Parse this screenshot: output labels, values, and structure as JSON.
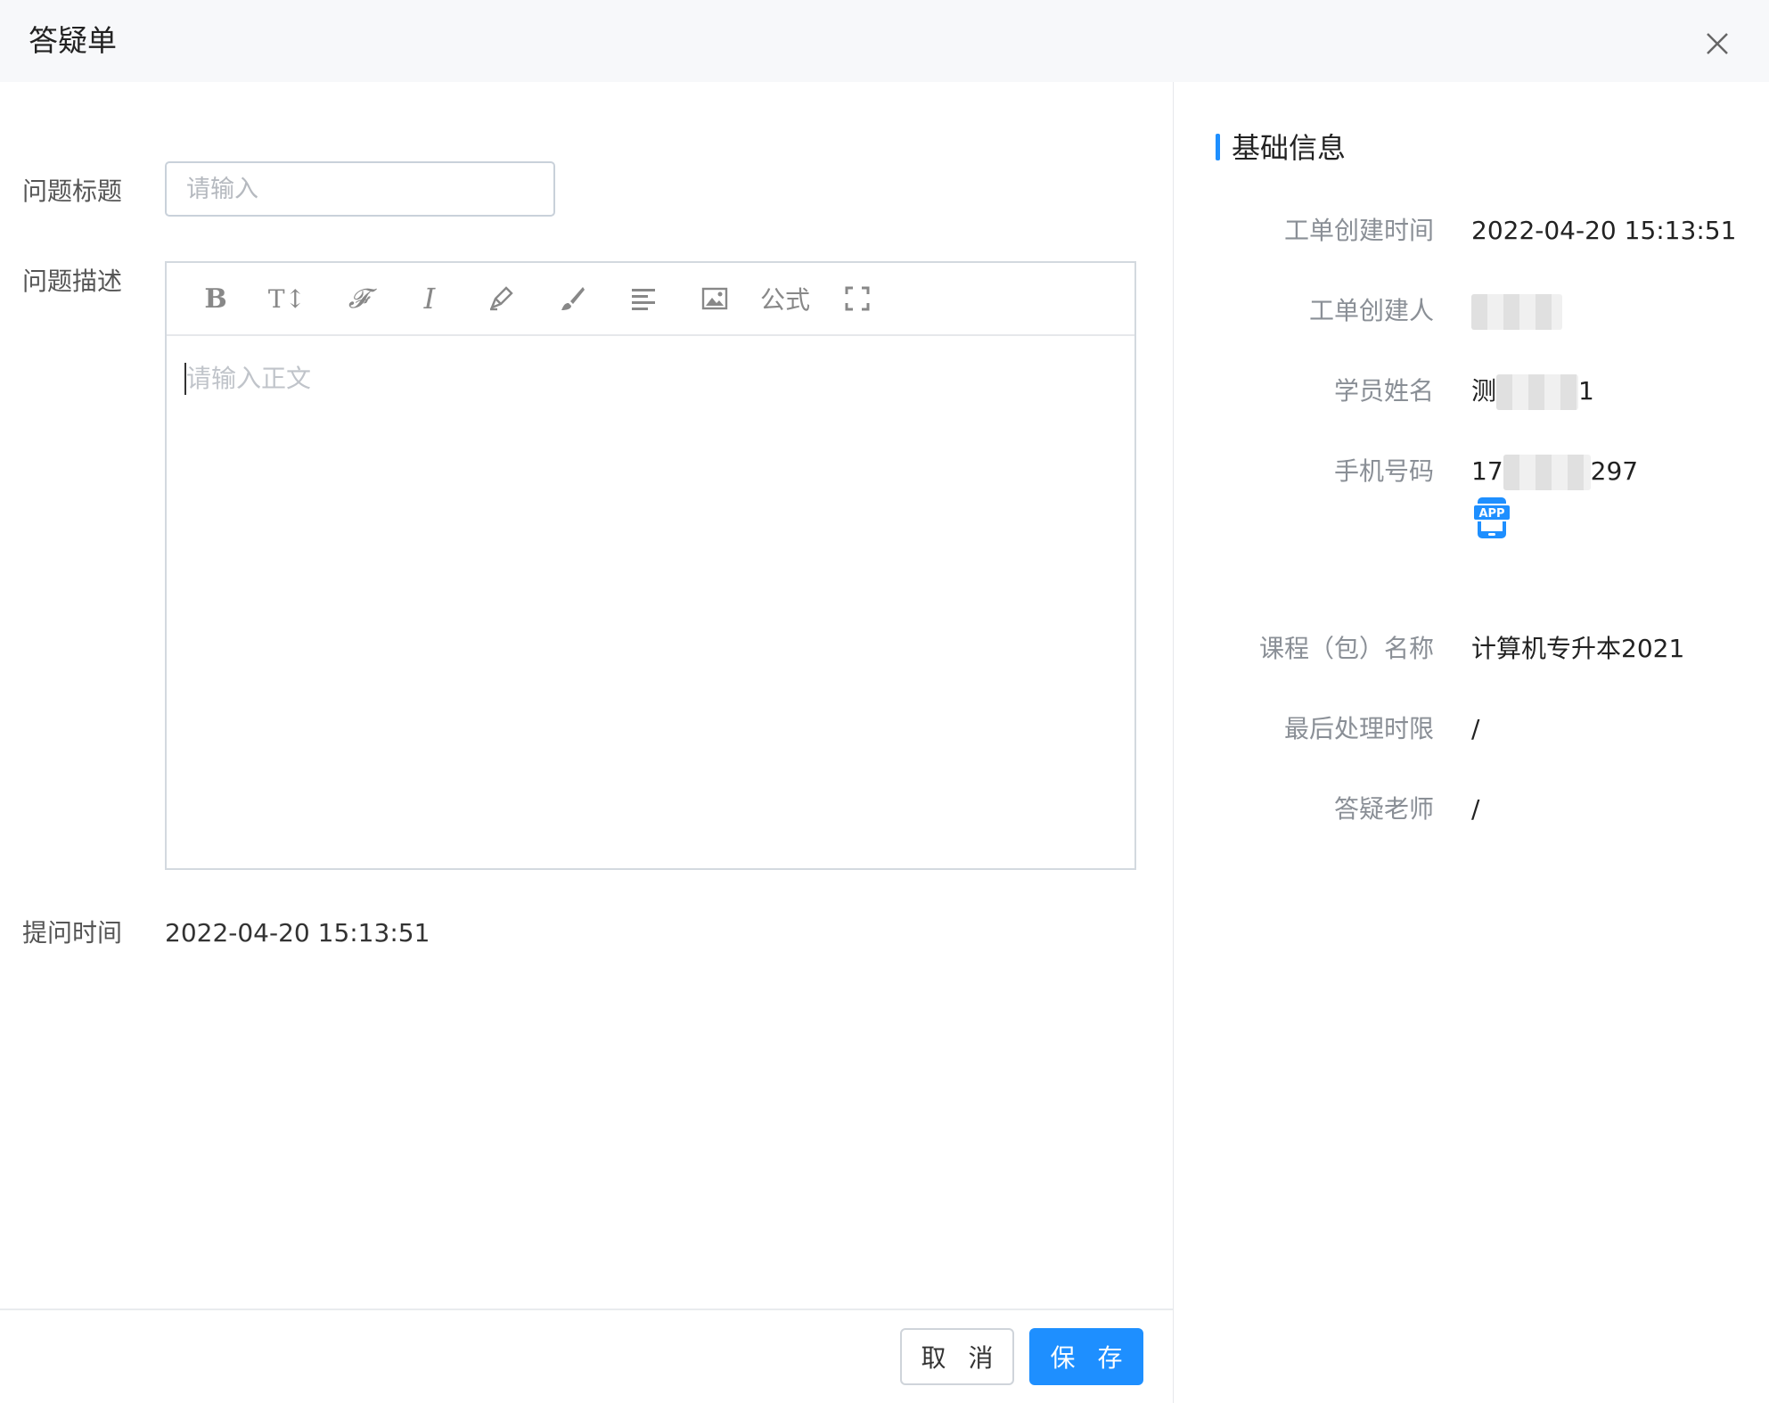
{
  "dialog": {
    "title": "答疑单",
    "close_icon": "close-icon"
  },
  "form": {
    "question_title": {
      "label": "问题标题",
      "placeholder": "请输入"
    },
    "question_desc": {
      "label": "问题描述",
      "placeholder": "请输入正文",
      "toolbar": {
        "bold": "B",
        "font_size": "T↕",
        "font_family": "𝓕",
        "italic": "I",
        "formula": "公式",
        "icons": [
          "bold-icon",
          "font-size-icon",
          "font-family-icon",
          "italic-icon",
          "highlight-pen-icon",
          "brush-icon",
          "align-icon",
          "image-icon",
          "formula-button",
          "fullscreen-icon"
        ]
      }
    },
    "ask_time": {
      "label": "提问时间",
      "value": "2022-04-20 15:13:51"
    }
  },
  "footer": {
    "cancel_label": "取 消",
    "save_label": "保 存",
    "accent": "#1e8fff"
  },
  "info": {
    "section_title": "基础信息",
    "rows": [
      {
        "label": "工单创建时间",
        "value": "2022-04-20 15:13:51"
      },
      {
        "label": "工单创建人",
        "value_prefix": "",
        "value_suffix": ""
      },
      {
        "label": "学员姓名",
        "value_prefix": "测",
        "value_suffix": "1"
      },
      {
        "label": "手机号码",
        "value_prefix": "17",
        "value_suffix": "297",
        "badge": "APP"
      },
      {
        "label": "课程（包）名称",
        "value": "计算机专升本2021"
      },
      {
        "label": "最后处理时限",
        "value": "/"
      },
      {
        "label": "答疑老师",
        "value": "/"
      }
    ]
  }
}
